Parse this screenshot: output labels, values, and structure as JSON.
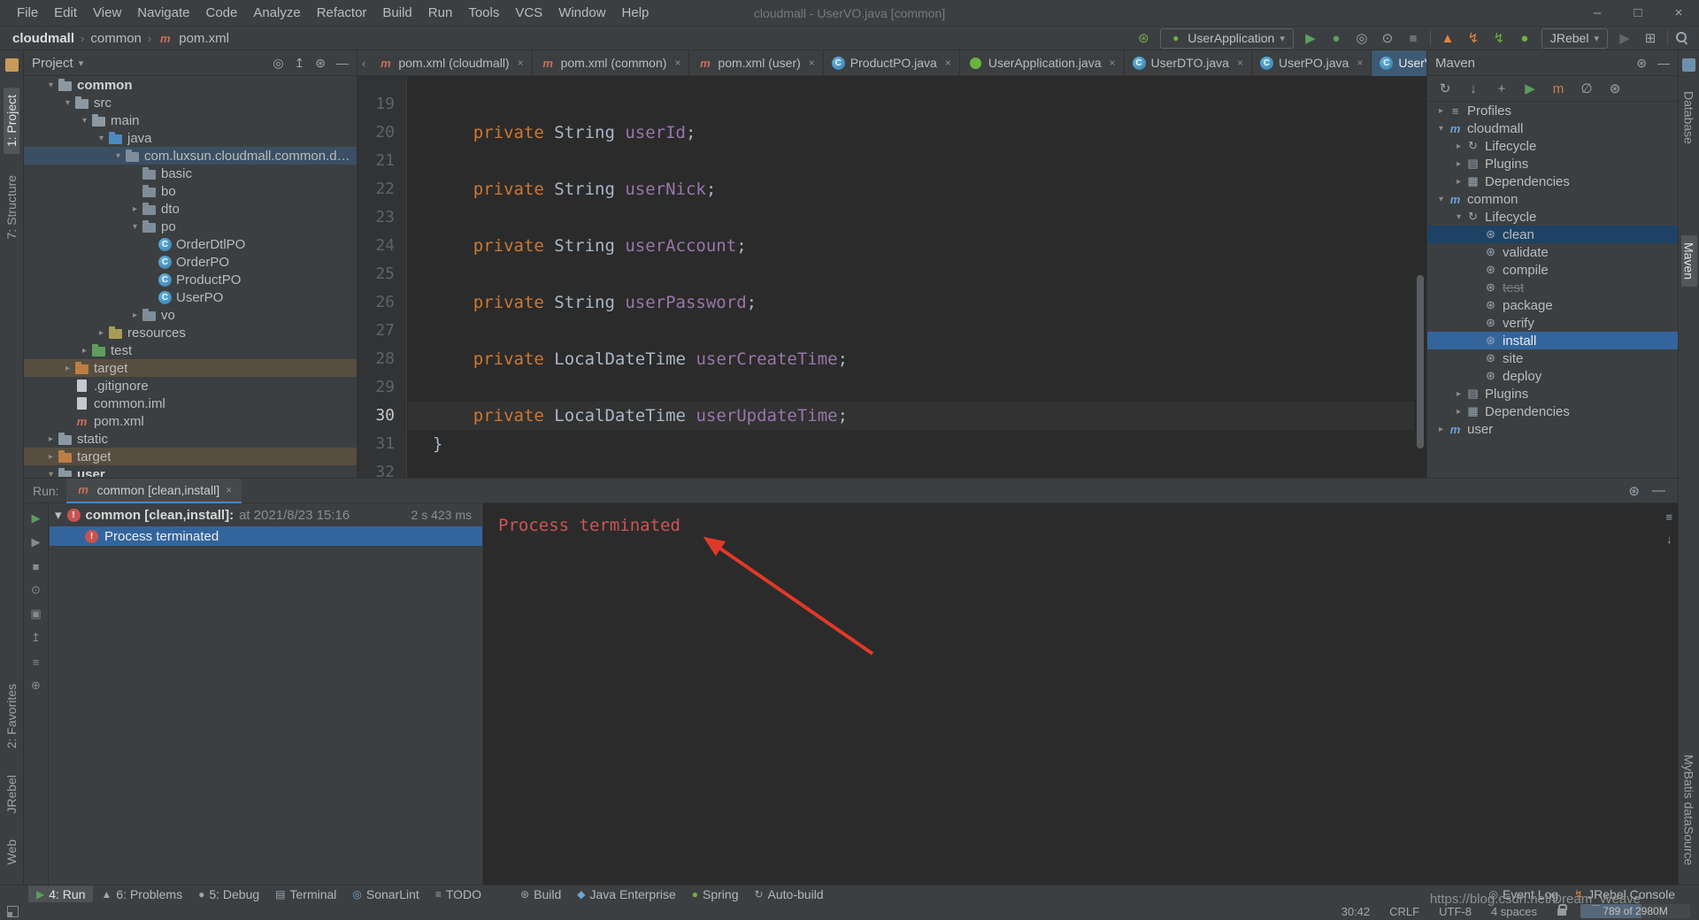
{
  "colors": {
    "accent": "#4a88c7",
    "selFocused": "#33659c",
    "selUnfocused": "#3a4f63",
    "selMuted": "#1d4265",
    "excludedBg": "rgba(187,134,66,0.22)",
    "errorRed": "#c75450",
    "consoleRed": "#cd5555",
    "arrowRed": "#e03928",
    "tabActive": "#3d5a74",
    "kw": "#cc7832",
    "field": "#9876aa",
    "code": "#a9b7c6"
  },
  "title_bar": {
    "menus": [
      "File",
      "Edit",
      "View",
      "Navigate",
      "Code",
      "Analyze",
      "Refactor",
      "Build",
      "Run",
      "Tools",
      "VCS",
      "Window",
      "Help"
    ],
    "title": "cloudmall - UserVO.java [common]",
    "window_controls": [
      {
        "name": "minimize-button",
        "glyph": "–"
      },
      {
        "name": "maximize-button",
        "glyph": "□"
      },
      {
        "name": "close-button",
        "glyph": "×"
      }
    ]
  },
  "toolbar": {
    "breadcrumbs": [
      "cloudmall",
      "common",
      "pom.xml"
    ],
    "right_items": [
      {
        "type": "icon",
        "name": "build-project-icon",
        "glyph": "⊛",
        "color": "#73a657"
      },
      {
        "type": "combo",
        "name": "run-config-combo",
        "label": "UserApplication",
        "icon_name": "spring-boot-icon",
        "icon_glyph": "●",
        "icon_color": "#6db33f"
      },
      {
        "type": "icon",
        "name": "run-button",
        "glyph": "▶",
        "color": "#5c9e5f"
      },
      {
        "type": "icon",
        "name": "debug-button",
        "glyph": "●",
        "color": "#5c9e5f"
      },
      {
        "type": "icon",
        "name": "coverage-button",
        "glyph": "◎",
        "color": "#9aa7b0"
      },
      {
        "type": "icon",
        "name": "profiler-button",
        "glyph": "⊙",
        "color": "#9aa7b0"
      },
      {
        "type": "icon",
        "name": "stop-button",
        "glyph": "■",
        "color": "#6e6e6e"
      },
      {
        "type": "sep"
      },
      {
        "type": "icon",
        "name": "jrebel-flame-icon",
        "glyph": "▲",
        "color": "#e8853d"
      },
      {
        "type": "icon",
        "name": "jrebel-lightning-icon",
        "glyph": "↯",
        "color": "#e8853d"
      },
      {
        "type": "icon",
        "name": "spring-reload-icon",
        "glyph": "↯",
        "color": "#6db33f"
      },
      {
        "type": "icon",
        "name": "leaf-icon",
        "glyph": "●",
        "color": "#6db33f"
      },
      {
        "type": "combo",
        "name": "jrebel-combo",
        "label": "JRebel"
      },
      {
        "type": "icon",
        "name": "rerun-disabled-icon",
        "glyph": "▶",
        "color": "#666666"
      },
      {
        "type": "icon",
        "name": "layout-icon",
        "glyph": "⊞",
        "color": "#9aa7b0"
      },
      {
        "type": "sep"
      },
      {
        "type": "search",
        "name": "search-everywhere-icon"
      }
    ]
  },
  "left_stripe": {
    "items_top": [
      {
        "label": "1: Project",
        "active": true,
        "mt": 18
      },
      {
        "label": "7: Structure",
        "active": false,
        "mt": 16
      }
    ],
    "items_bottom": [
      {
        "label": "2: Favorites",
        "active": false,
        "mt": 14
      },
      {
        "label": "JRebel",
        "active": false,
        "mt": 14
      },
      {
        "label": "Web",
        "active": false,
        "mt": 14
      }
    ]
  },
  "right_stripe": {
    "items_top": [
      {
        "label": "Database",
        "active": false,
        "mt": 14
      },
      {
        "label": "Maven",
        "active": true,
        "mt": 95
      }
    ],
    "items_bottom": [
      {
        "label": "MyBatis dataSource",
        "active": false,
        "mt": 14
      }
    ]
  },
  "project_panel": {
    "title": "Project",
    "header_icons": [
      {
        "name": "locate-file-icon",
        "glyph": "◎"
      },
      {
        "name": "collapse-all-icon",
        "glyph": "↥"
      },
      {
        "name": "settings-icon",
        "glyph": "⊛"
      },
      {
        "name": "hide-panel-icon",
        "glyph": "—"
      }
    ],
    "tree": [
      {
        "label": "common",
        "indent": 1,
        "chev": "open",
        "icon": "folder",
        "style": "module"
      },
      {
        "label": "src",
        "indent": 2,
        "chev": "open",
        "icon": "folder"
      },
      {
        "label": "main",
        "indent": 3,
        "chev": "open",
        "icon": "folder"
      },
      {
        "label": "java",
        "indent": 4,
        "chev": "open",
        "icon": "folder-blue"
      },
      {
        "label": "com.luxsun.cloudmall.common.domain",
        "indent": 5,
        "chev": "open",
        "icon": "package",
        "selected": "unfocused"
      },
      {
        "label": "basic",
        "indent": 6,
        "chev": "none",
        "icon": "package"
      },
      {
        "label": "bo",
        "indent": 6,
        "chev": "none",
        "icon": "package"
      },
      {
        "label": "dto",
        "indent": 6,
        "chev": "closed",
        "icon": "package"
      },
      {
        "label": "po",
        "indent": 6,
        "chev": "open",
        "icon": "package"
      },
      {
        "label": "OrderDtlPO",
        "indent": 7,
        "chev": "none",
        "icon": "class"
      },
      {
        "label": "OrderPO",
        "indent": 7,
        "chev": "none",
        "icon": "class"
      },
      {
        "label": "ProductPO",
        "indent": 7,
        "chev": "none",
        "icon": "class"
      },
      {
        "label": "UserPO",
        "indent": 7,
        "chev": "none",
        "icon": "class"
      },
      {
        "label": "vo",
        "indent": 6,
        "chev": "closed",
        "icon": "package"
      },
      {
        "label": "resources",
        "indent": 4,
        "chev": "closed",
        "icon": "folder-resources"
      },
      {
        "label": "test",
        "indent": 3,
        "chev": "closed",
        "icon": "folder-green"
      },
      {
        "label": "target",
        "indent": 2,
        "chev": "closed",
        "icon": "folder-orange",
        "rowbg": "excluded"
      },
      {
        "label": ".gitignore",
        "indent": 2,
        "chev": "none",
        "icon": "file"
      },
      {
        "label": "common.iml",
        "indent": 2,
        "chev": "none",
        "icon": "file"
      },
      {
        "label": "pom.xml",
        "indent": 2,
        "chev": "none",
        "icon": "maven-file"
      },
      {
        "label": "static",
        "indent": 1,
        "chev": "closed",
        "icon": "folder"
      },
      {
        "label": "target",
        "indent": 1,
        "chev": "closed",
        "icon": "folder-orange",
        "rowbg": "excluded"
      },
      {
        "label": "user",
        "indent": 1,
        "chev": "open",
        "icon": "folder",
        "style": "module"
      }
    ]
  },
  "editor": {
    "tabs": [
      {
        "label": "pom.xml (cloudmall)",
        "icon": "maven"
      },
      {
        "label": "pom.xml (common)",
        "icon": "maven"
      },
      {
        "label": "pom.xml (user)",
        "icon": "maven"
      },
      {
        "label": "ProductPO.java",
        "icon": "class"
      },
      {
        "label": "UserApplication.java",
        "icon": "spring"
      },
      {
        "label": "UserDTO.java",
        "icon": "class"
      },
      {
        "label": "UserPO.java",
        "icon": "class"
      },
      {
        "label": "UserVO.java",
        "icon": "class",
        "active": true
      }
    ],
    "lines": [
      {
        "n": "19",
        "t": []
      },
      {
        "n": "20",
        "t": [
          {
            "c": "pl",
            "x": "    "
          },
          {
            "c": "kw",
            "x": "private "
          },
          {
            "c": "ty",
            "x": "String "
          },
          {
            "c": "fd",
            "x": "userId"
          },
          {
            "c": "pl",
            "x": ";"
          }
        ]
      },
      {
        "n": "21",
        "t": []
      },
      {
        "n": "22",
        "t": [
          {
            "c": "pl",
            "x": "    "
          },
          {
            "c": "kw",
            "x": "private "
          },
          {
            "c": "ty",
            "x": "String "
          },
          {
            "c": "fd",
            "x": "userNick"
          },
          {
            "c": "pl",
            "x": ";"
          }
        ]
      },
      {
        "n": "23",
        "t": []
      },
      {
        "n": "24",
        "t": [
          {
            "c": "pl",
            "x": "    "
          },
          {
            "c": "kw",
            "x": "private "
          },
          {
            "c": "ty",
            "x": "String "
          },
          {
            "c": "fd",
            "x": "userAccount"
          },
          {
            "c": "pl",
            "x": ";"
          }
        ]
      },
      {
        "n": "25",
        "t": []
      },
      {
        "n": "26",
        "t": [
          {
            "c": "pl",
            "x": "    "
          },
          {
            "c": "kw",
            "x": "private "
          },
          {
            "c": "ty",
            "x": "String "
          },
          {
            "c": "fd",
            "x": "userPassword"
          },
          {
            "c": "pl",
            "x": ";"
          }
        ]
      },
      {
        "n": "27",
        "t": []
      },
      {
        "n": "28",
        "t": [
          {
            "c": "pl",
            "x": "    "
          },
          {
            "c": "kw",
            "x": "private "
          },
          {
            "c": "ty",
            "x": "LocalDateTime "
          },
          {
            "c": "fd",
            "x": "userCreateTime"
          },
          {
            "c": "pl",
            "x": ";"
          }
        ]
      },
      {
        "n": "29",
        "t": []
      },
      {
        "n": "30",
        "cur": true,
        "t": [
          {
            "c": "pl",
            "x": "    "
          },
          {
            "c": "kw",
            "x": "private "
          },
          {
            "c": "ty",
            "x": "LocalDateTime "
          },
          {
            "c": "fd",
            "x": "userUpdateTime"
          },
          {
            "c": "pl",
            "x": ";"
          }
        ]
      },
      {
        "n": "31",
        "t": [
          {
            "c": "pl",
            "x": "}"
          }
        ]
      },
      {
        "n": "32",
        "t": []
      }
    ]
  },
  "maven_panel": {
    "title": "Maven",
    "header_icons": [
      {
        "name": "settings-icon",
        "glyph": "⊛"
      },
      {
        "name": "hide-panel-icon",
        "glyph": "—"
      }
    ],
    "toolbar_icons": [
      {
        "name": "reimport-maven-icon",
        "glyph": "↻",
        "color": "#9aa7b0"
      },
      {
        "name": "download-sources-icon",
        "glyph": "↓",
        "color": "#9aa7b0"
      },
      {
        "name": "add-maven-project-icon",
        "glyph": "+",
        "color": "#9aa7b0"
      },
      {
        "name": "run-maven-goal-icon",
        "glyph": "▶",
        "color": "#5c9e5f"
      },
      {
        "name": "execute-maven-goal-icon",
        "glyph": "m",
        "color": "#c77d5a"
      },
      {
        "name": "skip-tests-icon",
        "glyph": "∅",
        "color": "#9aa7b0"
      },
      {
        "name": "maven-settings-icon",
        "glyph": "⊛",
        "color": "#9aa7b0"
      }
    ],
    "tree": [
      {
        "label": "Profiles",
        "indent": 0,
        "chev": "closed",
        "icon": "profiles"
      },
      {
        "label": "cloudmall",
        "indent": 0,
        "chev": "open",
        "icon": "maven-module"
      },
      {
        "label": "Lifecycle",
        "indent": 1,
        "chev": "closed",
        "icon": "lifecycle"
      },
      {
        "label": "Plugins",
        "indent": 1,
        "chev": "closed",
        "icon": "plugins"
      },
      {
        "label": "Dependencies",
        "indent": 1,
        "chev": "closed",
        "icon": "deps"
      },
      {
        "label": "common",
        "indent": 0,
        "chev": "open",
        "icon": "maven-module"
      },
      {
        "label": "Lifecycle",
        "indent": 1,
        "chev": "open",
        "icon": "lifecycle"
      },
      {
        "label": "clean",
        "indent": 2,
        "chev": "none",
        "icon": "goal",
        "selected": "muted"
      },
      {
        "label": "validate",
        "indent": 2,
        "chev": "none",
        "icon": "goal"
      },
      {
        "label": "compile",
        "indent": 2,
        "chev": "none",
        "icon": "goal"
      },
      {
        "label": "test",
        "indent": 2,
        "chev": "none",
        "icon": "goal",
        "style": "strike"
      },
      {
        "label": "package",
        "indent": 2,
        "chev": "none",
        "icon": "goal"
      },
      {
        "label": "verify",
        "indent": 2,
        "chev": "none",
        "icon": "goal"
      },
      {
        "label": "install",
        "indent": 2,
        "chev": "none",
        "icon": "goal",
        "selected": "focused"
      },
      {
        "label": "site",
        "indent": 2,
        "chev": "none",
        "icon": "goal"
      },
      {
        "label": "deploy",
        "indent": 2,
        "chev": "none",
        "icon": "goal"
      },
      {
        "label": "Plugins",
        "indent": 1,
        "chev": "closed",
        "icon": "plugins"
      },
      {
        "label": "Dependencies",
        "indent": 1,
        "chev": "closed",
        "icon": "deps"
      },
      {
        "label": "user",
        "indent": 0,
        "chev": "closed",
        "icon": "maven-module"
      }
    ]
  },
  "run_panel": {
    "label": "Run:",
    "tab": "common [clean,install]",
    "root_label": "common [clean,install]:",
    "root_time": "at 2021/8/23 15:16",
    "root_duration": "2 s 423 ms",
    "child_label": "Process terminated",
    "console_text": "Process terminated",
    "header_icons": [
      {
        "name": "settings-icon",
        "glyph": "⊛"
      },
      {
        "name": "hide-panel-icon",
        "glyph": "—"
      }
    ],
    "left_icons": [
      {
        "name": "rerun-icon",
        "glyph": "▶",
        "color": "#5c9e5f"
      },
      {
        "name": "rerun-failed-icon",
        "glyph": "▶",
        "color": "#8a8a8a"
      },
      {
        "name": "stop-icon",
        "glyph": "■",
        "color": "#8a8a8a"
      },
      {
        "name": "filter-icon",
        "glyph": "⊙",
        "color": "#8a8a8a"
      },
      {
        "name": "snapshot-icon",
        "glyph": "▣",
        "color": "#8a8a8a"
      },
      {
        "name": "expand-all-icon",
        "glyph": "↥",
        "color": "#8a8a8a"
      },
      {
        "name": "console-settings-icon",
        "glyph": "≡",
        "color": "#8a8a8a"
      },
      {
        "name": "pin-icon",
        "glyph": "⊕",
        "color": "#8a8a8a"
      }
    ],
    "console_icons": [
      {
        "name": "soft-wrap-icon",
        "glyph": "≡"
      },
      {
        "name": "scroll-to-end-icon",
        "glyph": "↓"
      }
    ]
  },
  "status_bar": {
    "tool_buttons_left": [
      {
        "label": "4: Run",
        "glyph": "▶",
        "color": "#5c9e5f",
        "active": true
      },
      {
        "label": "6: Problems",
        "glyph": "▲",
        "color": "#9aa7b0"
      },
      {
        "label": "5: Debug",
        "glyph": "●",
        "color": "#9aa7b0"
      },
      {
        "label": "Terminal",
        "glyph": "▤",
        "color": "#9aa7b0"
      },
      {
        "label": "SonarLint",
        "glyph": "◎",
        "color": "#6ba7d6"
      },
      {
        "label": "TODO",
        "glyph": "≡",
        "color": "#9aa7b0"
      },
      {
        "label": "Build",
        "glyph": "⊛",
        "color": "#9aa7b0",
        "gap": true
      },
      {
        "label": "Java Enterprise",
        "glyph": "◆",
        "color": "#6ba7d6"
      },
      {
        "label": "Spring",
        "glyph": "●",
        "color": "#6db33f"
      },
      {
        "label": "Auto-build",
        "glyph": "↻",
        "color": "#9aa7b0"
      }
    ],
    "tool_buttons_right": [
      {
        "label": "Event Log",
        "glyph": "◎",
        "color": "#9aa7b0"
      },
      {
        "label": "JRebel Console",
        "glyph": "↯",
        "color": "#e8853d"
      }
    ],
    "caret": "30:42",
    "line_ending": "CRLF",
    "encoding": "UTF-8",
    "indent": "4 spaces",
    "memory": "789 of 2980M",
    "watermark": "https://blog.csdn.net/Dream_Weave"
  }
}
